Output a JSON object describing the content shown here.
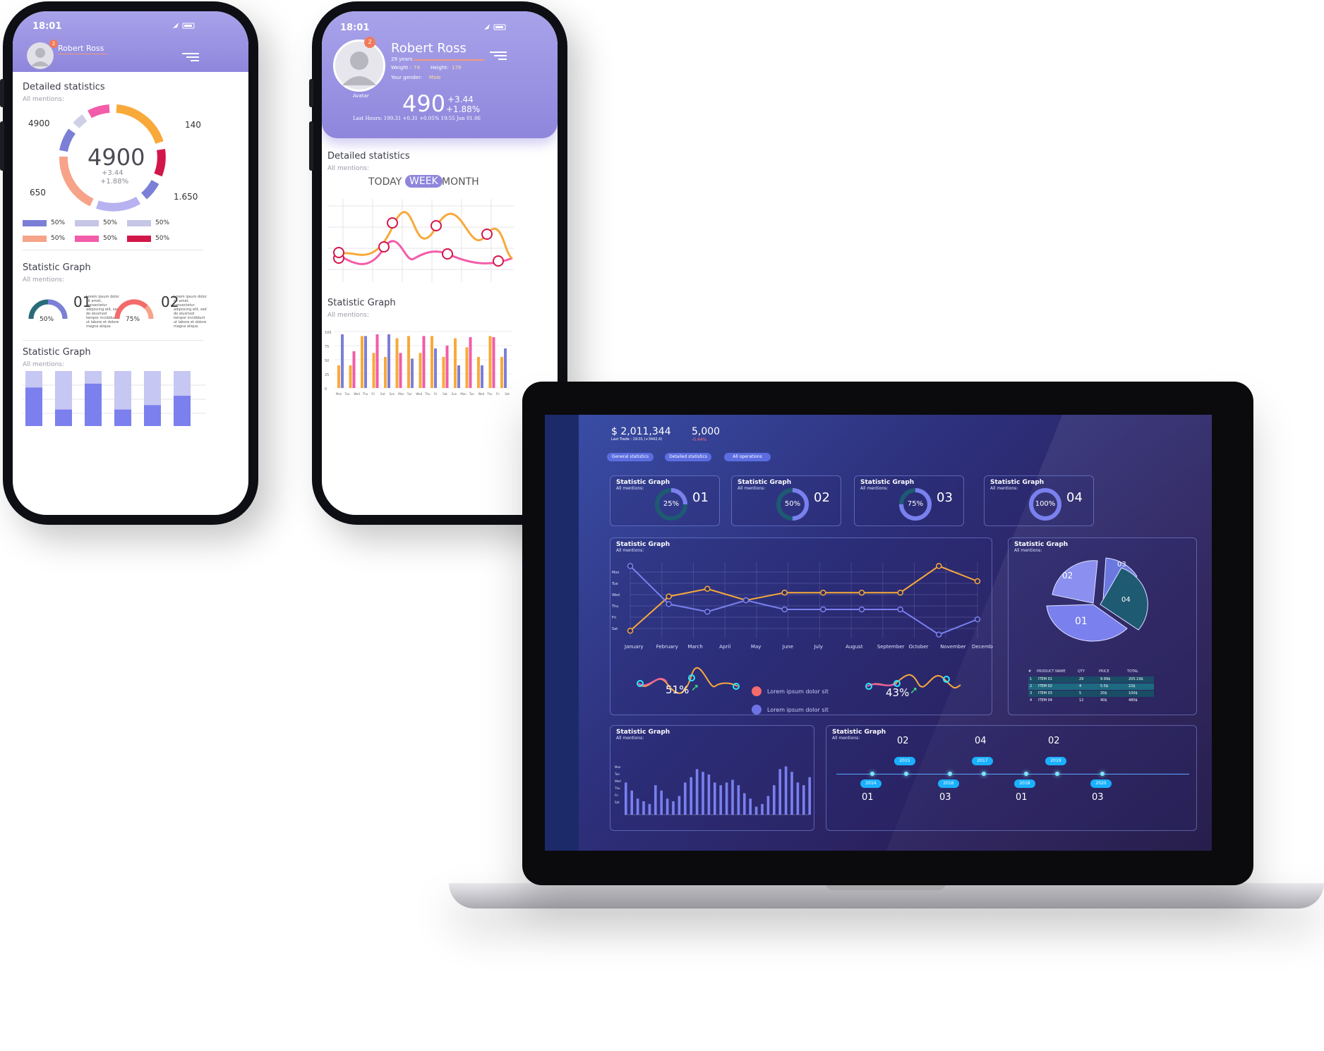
{
  "phone1": {
    "time": "18:01",
    "user_name": "Robert Ross",
    "notification_count": "2",
    "detailed_title": "Detailed statistics",
    "detailed_sub": "All mentions:",
    "donut_center": "4900",
    "donut_delta1": "+3.44",
    "donut_delta2": "+1.88%",
    "label_tl": "4900",
    "label_tr": "140",
    "label_bl": "650",
    "label_br": "1.650",
    "legend": [
      {
        "pct": "50%",
        "color": "#7b7fd6"
      },
      {
        "pct": "50%",
        "color": "#c6c7e6"
      },
      {
        "pct": "50%",
        "color": "#c6c7e6"
      },
      {
        "pct": "50%",
        "color": "#f6a38a"
      },
      {
        "pct": "50%",
        "color": "#f25ca8"
      },
      {
        "pct": "50%",
        "color": "#d3164a"
      }
    ],
    "graph1_title": "Statistic Graph",
    "graph1_sub": "All mentions:",
    "gauge1_pct": "50%",
    "gauge1_num": "01",
    "gauge2_pct": "75%",
    "gauge2_num": "02",
    "lorem": "Lorem ipsum dolor sit amet, consectetur adipiscing elit, sed do eiusmod tempor incididunt ut labore et dolore magna aliqua.",
    "graph2_title": "Statistic Graph",
    "graph2_sub": "All mentions:",
    "bars": [
      {
        "total": 1.0,
        "fill": 0.7
      },
      {
        "total": 1.0,
        "fill": 0.3
      },
      {
        "total": 1.0,
        "fill": 0.77
      },
      {
        "total": 1.0,
        "fill": 0.3
      },
      {
        "total": 1.0,
        "fill": 0.38
      },
      {
        "total": 1.0,
        "fill": 0.55
      }
    ]
  },
  "phone2": {
    "time": "18:01",
    "notification_count": "2",
    "user_name": "Robert Ross",
    "age": "29 years",
    "weight_label": "Weight :",
    "weight_value": "74",
    "height_label": "Height:",
    "height_value": "179",
    "gender_label": "Your gender:",
    "gender_value": "Male",
    "avatar_label": "Avatar",
    "big_number": "490",
    "delta1": "+3.44",
    "delta2": "+1.88%",
    "last_hours": "Last Hours: 199.31 +0.31 +0.05% 19:55 Jun 01.06",
    "detailed_title": "Detailed statistics",
    "detailed_sub": "All mentions:",
    "tabs": [
      "TODAY",
      "WEEK",
      "MONTH"
    ],
    "graph_title": "Statistic Graph",
    "graph_sub": "All mentions:",
    "bar_axis": [
      "100",
      "75",
      "50",
      "25",
      "0"
    ],
    "bar_days": [
      "Mon",
      "Tue",
      "Wed",
      "Thu",
      "Fri",
      "Sat",
      "Sun",
      "Mon",
      "Tue",
      "Wed",
      "Thu",
      "Fri",
      "Sat",
      "Sun",
      "Mon",
      "Tue",
      "Wed",
      "Thu",
      "Fri",
      "Sat"
    ],
    "bar_pairs": [
      [
        40,
        95
      ],
      [
        40,
        65
      ],
      [
        92,
        92
      ],
      [
        62,
        95
      ],
      [
        55,
        95
      ],
      [
        88,
        62
      ],
      [
        92,
        52
      ],
      [
        62,
        92
      ],
      [
        92,
        70
      ],
      [
        55,
        75
      ],
      [
        88,
        40
      ],
      [
        72,
        90
      ],
      [
        55,
        40
      ],
      [
        92,
        90
      ],
      [
        55,
        70
      ]
    ]
  },
  "laptop": {
    "total": "$ 2,011,344",
    "total_sub": "Last Trade : 19:01 (+3442,4)",
    "secondary": "5,000",
    "secondary_sub": "-0.44%",
    "tabs": [
      "General statistics",
      "Detailed statistics",
      "All operations"
    ],
    "stat_cards": [
      {
        "title": "Statistic Graph",
        "sub": "All mentions:",
        "pct": "25%",
        "num": "01"
      },
      {
        "title": "Statistic Graph",
        "sub": "All mentions:",
        "pct": "50%",
        "num": "02"
      },
      {
        "title": "Statistic Graph",
        "sub": "All mentions:",
        "pct": "75%",
        "num": "03"
      },
      {
        "title": "Statistic Graph",
        "sub": "All mentions:",
        "pct": "100%",
        "num": "04"
      }
    ],
    "line_panel": {
      "title": "Statistic Graph",
      "sub": "All mentions:",
      "y_days": [
        "Mon",
        "Tue",
        "Wed",
        "Thu",
        "Fri",
        "Sat"
      ],
      "months": [
        "January",
        "February",
        "March",
        "April",
        "May",
        "June",
        "July",
        "August",
        "September",
        "October",
        "November",
        "December"
      ],
      "series_orange": [
        0.1,
        0.55,
        0.65,
        0.5,
        0.6,
        0.6,
        0.6,
        0.6,
        0.95,
        0.75
      ],
      "series_blue": [
        0.95,
        0.45,
        0.35,
        0.5,
        0.38,
        0.38,
        0.38,
        0.38,
        0.05,
        0.25
      ],
      "wave1_pct": "51%",
      "wave2_pct": "43%",
      "legend1": "Lorem ipsum dolor sit",
      "legend2": "Lorem ipsum dolor sit"
    },
    "pie_panel": {
      "title": "Statistic Graph",
      "sub": "All mentions:",
      "labels": [
        "02",
        "03",
        "04",
        "01"
      ],
      "table_headers": [
        "#",
        "PRODUCT NAME",
        "QTY",
        "PRICE",
        "TOTAL"
      ],
      "table_rows": [
        [
          "1",
          "ITEM 01",
          "29",
          "9.99$",
          "205.19$"
        ],
        [
          "2",
          "ITEM 02",
          "4",
          "5.5$",
          "22$"
        ],
        [
          "3",
          "ITEM 03",
          "5",
          "20$",
          "100$"
        ],
        [
          "4",
          "ITEM 04",
          "12",
          "40$",
          "480$"
        ]
      ]
    },
    "bar_panel": {
      "title": "Statistic Graph",
      "sub": "All mentions:",
      "y_days": [
        "Mon",
        "Tue",
        "Wed",
        "Thu",
        "Fri",
        "Sat"
      ],
      "values": [
        0.6,
        0.45,
        0.3,
        0.25,
        0.2,
        0.55,
        0.45,
        0.3,
        0.25,
        0.35,
        0.6,
        0.7,
        0.85,
        0.8,
        0.75,
        0.6,
        0.55,
        0.6,
        0.65,
        0.55,
        0.4,
        0.3,
        0.15,
        0.2,
        0.35,
        0.55,
        0.85,
        0.9,
        0.8,
        0.6,
        0.55,
        0.7
      ]
    },
    "timeline_panel": {
      "title": "Statistic Graph",
      "sub": "All mentions:",
      "top_years": [
        "2015",
        "2017",
        "2019"
      ],
      "top_nums": [
        "02",
        "04",
        "02"
      ],
      "bottom_years": [
        "2014",
        "2016",
        "2018",
        "2020"
      ],
      "bottom_nums": [
        "01",
        "03",
        "01",
        "03"
      ]
    }
  }
}
